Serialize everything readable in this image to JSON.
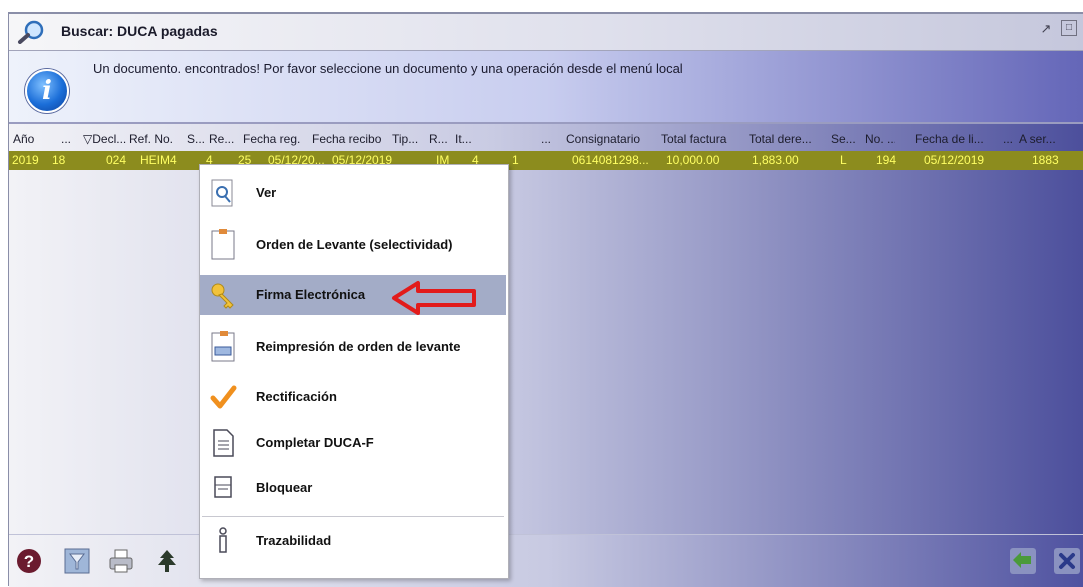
{
  "window": {
    "title": "Buscar: DUCA pagadas",
    "icons": [
      "search-icon",
      "restore-icon",
      "maximize-icon"
    ]
  },
  "message": {
    "text": "Un documento. encontrados! Por favor seleccione un documento y una operación desde el menú local",
    "icon": "info-icon"
  },
  "table": {
    "headers": [
      "Año",
      "...",
      "▽Decl...",
      "Ref. No.",
      "S...",
      "Re...",
      "Fecha reg.",
      "Fecha recibo",
      "Tip...",
      "R...",
      "It...",
      "...",
      "Consignatario",
      "Total factura",
      "Total dere...",
      "Se...",
      "No. ...",
      "Fecha de li...",
      "...",
      "A ser..."
    ],
    "row": [
      "2019",
      "18",
      "024",
      "HEIM4",
      "4",
      "25",
      "05/12/20...",
      "05/12/2019",
      "IM",
      "4",
      "1",
      "",
      "0614081298...",
      "10,000.00",
      "1,883.00",
      "L",
      "194",
      "05/12/2019",
      "",
      "1883"
    ],
    "row_colors": {
      "background": "#8c8c1e",
      "text": "#ffff63"
    }
  },
  "context_menu": {
    "items": [
      {
        "label": "Ver",
        "icon": "magnifier-icon"
      },
      {
        "label": "Orden de Levante (selectividad)",
        "icon": "document-icon"
      },
      {
        "label": "Firma Electrónica",
        "icon": "key-icon",
        "selected": true
      },
      {
        "label": "Reimpresión de orden de levante",
        "icon": "reprint-icon"
      },
      {
        "label": "Rectificación",
        "icon": "checkmark-icon"
      },
      {
        "label": "Completar DUCA-F",
        "icon": "form-icon"
      },
      {
        "label": "Bloquear",
        "icon": "block-icon"
      },
      {
        "label": "Trazabilidad",
        "icon": "trace-icon"
      }
    ],
    "annotation": "red-arrow-pointing-left",
    "annotation_color": "#e21b1b"
  },
  "bottom_toolbar": {
    "icons": [
      "help-icon",
      "filter-icon",
      "printer-icon",
      "tree-icon",
      "accept-icon",
      "close-icon"
    ]
  }
}
